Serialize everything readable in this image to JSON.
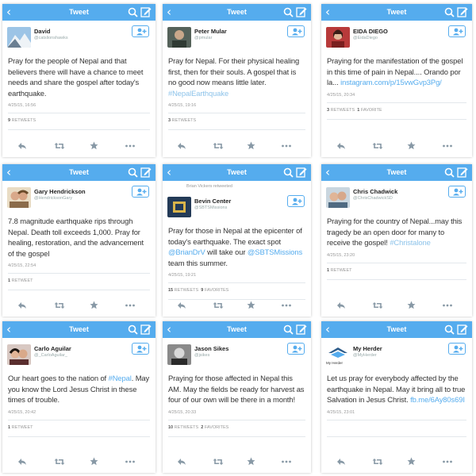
{
  "header": {
    "back_glyph": "‹",
    "title": "Tweet"
  },
  "panels": [
    {
      "name": "David",
      "handle": "@catslionshawks",
      "retweeted_by": "",
      "segments": [
        {
          "t": "Pray for the people of Nepal and that believers there will have a chance to meet needs and share the gospel after today's earthquake.",
          "k": "text"
        }
      ],
      "date": "4/25/15, 16:56",
      "stats": [
        {
          "n": "9",
          "l": "RETWEETS"
        }
      ],
      "avatar": "mountain"
    },
    {
      "name": "Peter Mular",
      "handle": "@pmular",
      "retweeted_by": "",
      "segments": [
        {
          "t": "Pray for Nepal. For their physical healing first, then for their souls. A gospel that is no good now means little later. ",
          "k": "text"
        },
        {
          "t": "#NepalEarthquake",
          "k": "tag"
        }
      ],
      "date": "4/25/15, 19:16",
      "stats": [
        {
          "n": "3",
          "l": "RETWEETS"
        }
      ],
      "avatar": "person-dark"
    },
    {
      "name": "EIDA DIEGO",
      "handle": "@EidaDiego",
      "retweeted_by": "",
      "segments": [
        {
          "t": "Praying for the manifestation of the gospel in this time of pain in Nepal.... Orando por la... ",
          "k": "text"
        },
        {
          "t": "instagram.com/p/15vwGvp3Pg/",
          "k": "link"
        }
      ],
      "date": "4/25/15, 20:34",
      "stats": [
        {
          "n": "3",
          "l": "RETWEETS"
        },
        {
          "n": "1",
          "l": "FAVORITE"
        }
      ],
      "avatar": "person-red"
    },
    {
      "name": "Gary Hendrickson",
      "handle": "@HendricksonGary",
      "retweeted_by": "",
      "segments": [
        {
          "t": "7.8 magnitude earthquake rips through Nepal. Death toll exceeds 1,000. Pray for healing, restoration, and the advancement of the gospel",
          "k": "text"
        }
      ],
      "date": "4/25/15, 22:54",
      "stats": [
        {
          "n": "1",
          "l": "RETWEET"
        }
      ],
      "avatar": "couple"
    },
    {
      "name": "Bevin Center",
      "handle": "@SBTSMissions",
      "retweeted_by": "Brian Vickers retweeted",
      "segments": [
        {
          "t": "Pray for those in Nepal at the epicenter of today's earthquake. The exact spot ",
          "k": "text"
        },
        {
          "t": "@BrianDrV",
          "k": "link"
        },
        {
          "t": " will take our ",
          "k": "text"
        },
        {
          "t": "@SBTSMissions",
          "k": "link"
        },
        {
          "t": " team this summer.",
          "k": "text"
        }
      ],
      "date": "4/25/15, 19:21",
      "stats": [
        {
          "n": "15",
          "l": "RETWEETS"
        },
        {
          "n": "9",
          "l": "FAVORITES"
        }
      ],
      "avatar": "logo"
    },
    {
      "name": "Chris Chadwick",
      "handle": "@ChrisChadwickSD",
      "retweeted_by": "",
      "segments": [
        {
          "t": "Praying for the country of Nepal...may this tragedy be an open door for many to receive the gospel! ",
          "k": "text"
        },
        {
          "t": "#Christalone",
          "k": "tag"
        }
      ],
      "date": "4/25/15, 23:20",
      "stats": [
        {
          "n": "1",
          "l": "RETWEET"
        }
      ],
      "avatar": "couple2"
    },
    {
      "name": "Carlo Aguilar",
      "handle": "@_CarloAguilar_",
      "retweeted_by": "",
      "segments": [
        {
          "t": "Our heart goes to the nation of ",
          "k": "text"
        },
        {
          "t": "#Nepal",
          "k": "link"
        },
        {
          "t": ". May you know the Lord Jesus Christ in these times of trouble.",
          "k": "text"
        }
      ],
      "date": "4/25/15, 20:42",
      "stats": [
        {
          "n": "1",
          "l": "RETWEET"
        }
      ],
      "avatar": "couple3"
    },
    {
      "name": "Jason Sikes",
      "handle": "@jsikes",
      "retweeted_by": "",
      "segments": [
        {
          "t": "Praying for those affected in Nepal this AM. May the fields be ready for harvest as four of our own will be there in a month!",
          "k": "text"
        }
      ],
      "date": "4/25/15, 20:33",
      "stats": [
        {
          "n": "10",
          "l": "RETWEETS"
        },
        {
          "n": "2",
          "l": "FAVORITES"
        }
      ],
      "avatar": "person-bw"
    },
    {
      "name": "My Herder",
      "handle": "@MyHerder",
      "retweeted_by": "",
      "segments": [
        {
          "t": "Let us pray for everybody affected by the earthquake in Nepal. May it bring all to true Salvation in Jesus Christ. ",
          "k": "text"
        },
        {
          "t": "fb.me/6Ay80s69I",
          "k": "link"
        }
      ],
      "date": "4/25/15, 23:01",
      "stats": [],
      "avatar": "herder",
      "avatar_caption": "My Herder"
    }
  ],
  "colors": {
    "header": "#55acee",
    "link": "#55acee",
    "tag": "#8dc3ea"
  },
  "icons": [
    "back-icon",
    "search-icon",
    "compose-icon",
    "follow-icon",
    "reply-icon",
    "retweet-icon",
    "favorite-icon",
    "more-icon"
  ]
}
